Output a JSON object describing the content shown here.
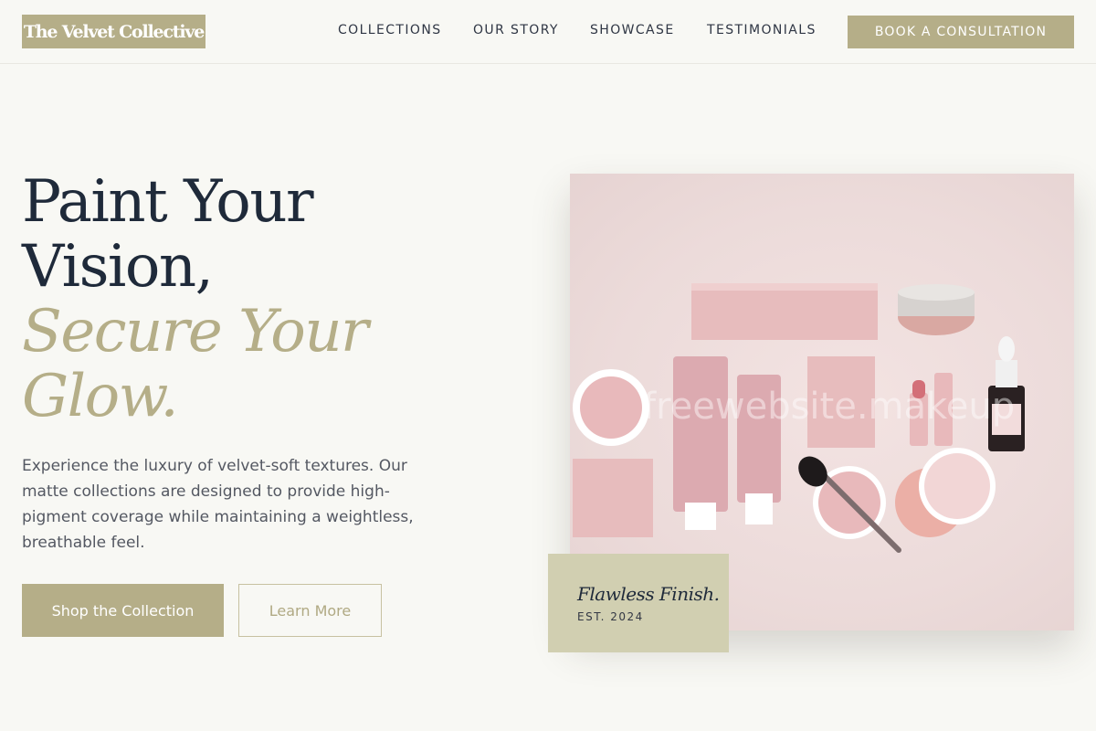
{
  "brand": {
    "name": "The Velvet Collective"
  },
  "nav": {
    "items": [
      {
        "label": "COLLECTIONS"
      },
      {
        "label": "OUR STORY"
      },
      {
        "label": "SHOWCASE"
      },
      {
        "label": "TESTIMONIALS"
      }
    ],
    "cta_label": "BOOK A CONSULTATION"
  },
  "hero": {
    "headline": {
      "line1": "Paint Your",
      "line2": "Vision,",
      "line3": "Secure Your",
      "line4": "Glow."
    },
    "lead": "Experience the luxury of velvet-soft textures. Our matte collections are designed to provide high-pigment coverage while maintaining a weightless, breathable feel.",
    "primary_button": "Shop the Collection",
    "secondary_button": "Learn More",
    "image_watermark": "freewebsite.makeup",
    "badge": {
      "title": "Flawless Finish.",
      "subtitle": "EST. 2024"
    }
  },
  "colors": {
    "accent": "#b5ae88",
    "background": "#f8f8f4",
    "navy": "#1f2a3a",
    "badge": "#d1cfb1",
    "product_pink": "#e2b5b8"
  }
}
